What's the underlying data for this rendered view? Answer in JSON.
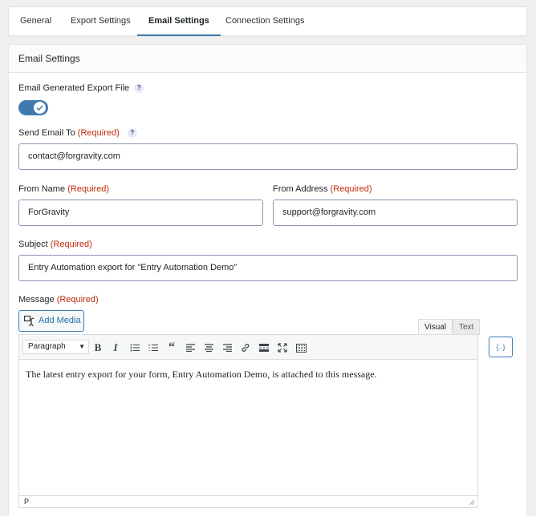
{
  "tabs": [
    {
      "label": "General"
    },
    {
      "label": "Export Settings"
    },
    {
      "label": "Email Settings"
    },
    {
      "label": "Connection Settings"
    }
  ],
  "panel": {
    "title": "Email Settings"
  },
  "fields": {
    "email_export": {
      "label": "Email Generated Export File",
      "help": "?",
      "enabled": true
    },
    "send_to": {
      "label": "Send Email To",
      "required": "(Required)",
      "help": "?",
      "value": "contact@forgravity.com"
    },
    "from_name": {
      "label": "From Name",
      "required": "(Required)",
      "value": "ForGravity"
    },
    "from_address": {
      "label": "From Address",
      "required": "(Required)",
      "value": "support@forgravity.com"
    },
    "subject": {
      "label": "Subject",
      "required": "(Required)",
      "value": "Entry Automation export for \"Entry Automation Demo\""
    },
    "message": {
      "label": "Message",
      "required": "(Required)"
    }
  },
  "editor": {
    "add_media": "Add Media",
    "tab_visual": "Visual",
    "tab_text": "Text",
    "format": "Paragraph",
    "content": "The latest entry export for your form, Entry Automation Demo, is attached to this message.",
    "path": "P",
    "merge_tag": "{..}",
    "toolbar_icons": [
      "bold-icon",
      "italic-icon",
      "bullet-list-icon",
      "numbered-list-icon",
      "blockquote-icon",
      "align-left-icon",
      "align-center-icon",
      "align-right-icon",
      "link-icon",
      "read-more-icon",
      "fullscreen-icon",
      "toolbar-toggle-icon"
    ]
  },
  "colors": {
    "accent": "#3e7ab0",
    "required": "#c02b0a"
  }
}
